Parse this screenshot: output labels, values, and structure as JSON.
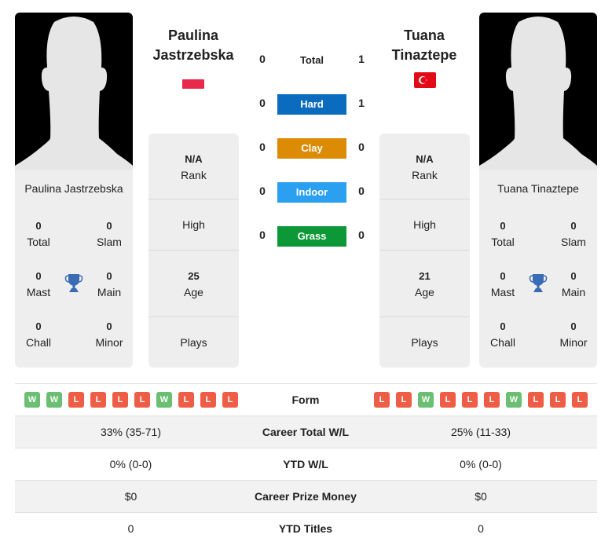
{
  "player1": {
    "name_line1": "Paulina",
    "name_line2": "Jastrzebska",
    "full_name": "Paulina Jastrzebska",
    "flag": "poland-flag",
    "titles": {
      "total": {
        "value": "0",
        "label": "Total"
      },
      "slam": {
        "value": "0",
        "label": "Slam"
      },
      "mast": {
        "value": "0",
        "label": "Mast"
      },
      "main": {
        "value": "0",
        "label": "Main"
      },
      "chall": {
        "value": "0",
        "label": "Chall"
      },
      "minor": {
        "value": "0",
        "label": "Minor"
      }
    },
    "info": {
      "rank": {
        "value": "N/A",
        "label": "Rank"
      },
      "high": {
        "label": "High"
      },
      "age": {
        "value": "25",
        "label": "Age"
      },
      "plays": {
        "label": "Plays"
      }
    },
    "form": [
      "W",
      "W",
      "L",
      "L",
      "L",
      "L",
      "W",
      "L",
      "L",
      "L"
    ],
    "career_wl": "33% (35-71)",
    "ytd_wl": "0% (0-0)",
    "prize_money": "$0",
    "ytd_titles": "0"
  },
  "player2": {
    "name_line1": "Tuana",
    "name_line2": "Tinaztepe",
    "full_name": "Tuana Tinaztepe",
    "flag": "turkey-flag",
    "titles": {
      "total": {
        "value": "0",
        "label": "Total"
      },
      "slam": {
        "value": "0",
        "label": "Slam"
      },
      "mast": {
        "value": "0",
        "label": "Mast"
      },
      "main": {
        "value": "0",
        "label": "Main"
      },
      "chall": {
        "value": "0",
        "label": "Chall"
      },
      "minor": {
        "value": "0",
        "label": "Minor"
      }
    },
    "info": {
      "rank": {
        "value": "N/A",
        "label": "Rank"
      },
      "high": {
        "label": "High"
      },
      "age": {
        "value": "21",
        "label": "Age"
      },
      "plays": {
        "label": "Plays"
      }
    },
    "form": [
      "L",
      "L",
      "W",
      "L",
      "L",
      "L",
      "W",
      "L",
      "L",
      "L"
    ],
    "career_wl": "25% (11-33)",
    "ytd_wl": "0% (0-0)",
    "prize_money": "$0",
    "ytd_titles": "0"
  },
  "h2h": {
    "total": {
      "label": "Total",
      "p1": "0",
      "p2": "1"
    },
    "surfaces": [
      {
        "label": "Hard",
        "p1": "0",
        "p2": "1",
        "color": "#0a6bbf"
      },
      {
        "label": "Clay",
        "p1": "0",
        "p2": "0",
        "color": "#dc8c04"
      },
      {
        "label": "Indoor",
        "p1": "0",
        "p2": "0",
        "color": "#2b9ff0"
      },
      {
        "label": "Grass",
        "p1": "0",
        "p2": "0",
        "color": "#0d9838"
      }
    ]
  },
  "table": {
    "form_label": "Form",
    "career_wl_label": "Career Total W/L",
    "ytd_wl_label": "YTD W/L",
    "prize_label": "Career Prize Money",
    "ytd_titles_label": "YTD Titles"
  },
  "colors": {
    "win": "#6bbf72",
    "loss": "#ee5e47",
    "trophy": "#3a6cb5"
  }
}
